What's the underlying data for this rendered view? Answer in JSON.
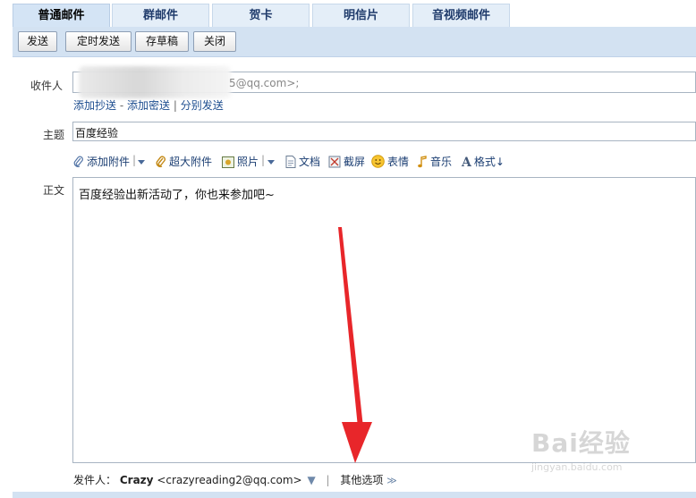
{
  "tabs": [
    {
      "label": "普通邮件",
      "active": true
    },
    {
      "label": "群邮件",
      "active": false
    },
    {
      "label": "贺卡",
      "active": false
    },
    {
      "label": "明信片",
      "active": false
    },
    {
      "label": "音视频邮件",
      "active": false
    }
  ],
  "toolbar": {
    "send_label": "发送",
    "scheduled_send_label": "定时发送",
    "save_draft_label": "存草稿",
    "close_label": "关闭"
  },
  "recipient": {
    "label": "收件人",
    "value_visible_suffix": "5@qq.com>;",
    "add_cc": "添加抄送",
    "dash": "-",
    "add_bcc": "添加密送",
    "pipe": "|",
    "separate_send": "分别发送"
  },
  "subject": {
    "label": "主题",
    "value": "百度经验"
  },
  "attachments": {
    "add_attachment": "添加附件",
    "large_attachment": "超大附件",
    "photo": "照片",
    "document": "文档",
    "screenshot": "截屏",
    "emoticon": "表情",
    "music": "音乐",
    "format": "格式↓"
  },
  "body": {
    "label": "正文",
    "text": "百度经验出新活动了，你也来参加吧~"
  },
  "footer": {
    "sender_label": "发件人：",
    "sender_name": "Crazy",
    "sender_email": "<crazyreading2@qq.com>",
    "dropdown_glyph": "▼",
    "pipe": "|",
    "other_options": "其他选项",
    "expand_glyph": "≫"
  },
  "watermark": {
    "brand": "Bai经验",
    "url": "jingyan.baidu.com"
  },
  "colors": {
    "toolbar_bg": "#d3e2f2",
    "tab_bg": "#e4eef8",
    "link": "#1d4d8f",
    "arrow": "#e8262a"
  }
}
